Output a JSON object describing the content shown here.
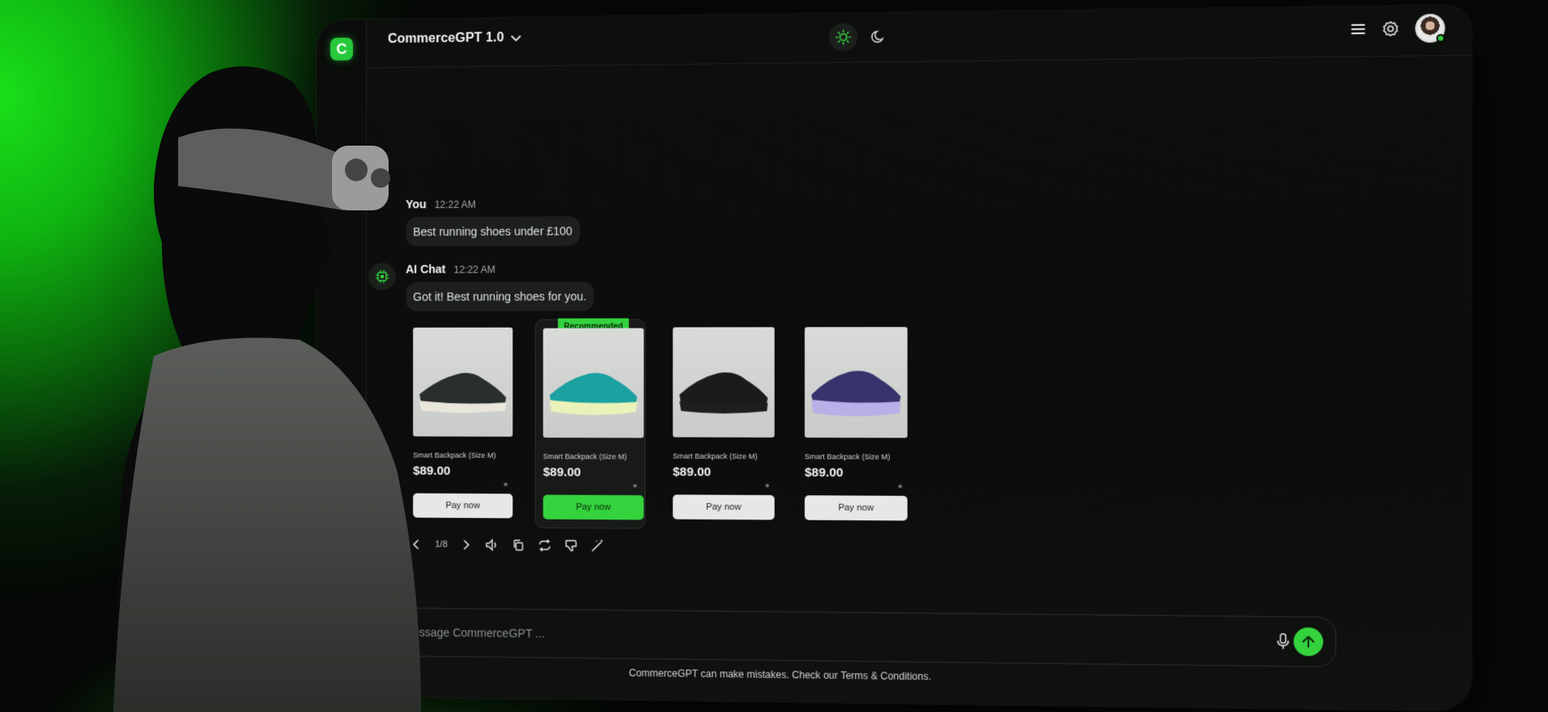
{
  "header": {
    "model_name": "CommerceGPT 1.0",
    "logo_letter": "C"
  },
  "chat": {
    "user": {
      "author": "You",
      "time": "12:22 AM",
      "text": "Best running shoes under £100"
    },
    "ai": {
      "author": "AI Chat",
      "time": "12:22 AM",
      "text": "Got it! Best running shoes for you."
    }
  },
  "products": [
    {
      "name": "Smart Backpack (Size M)",
      "price": "$89.00",
      "button": "Pay now",
      "recommended": false,
      "shoe_color": "#2a2e2c",
      "sole_color": "#e9e6dc"
    },
    {
      "name": "Smart Backpack (Size M)",
      "price": "$89.00",
      "button": "Pay now",
      "recommended": true,
      "badge": "Recommended",
      "shoe_color": "#1aa1a0",
      "sole_color": "#eaf1b9"
    },
    {
      "name": "Smart Backpack (Size M)",
      "price": "$89.00",
      "button": "Pay now",
      "recommended": false,
      "shoe_color": "#1a1b1c",
      "sole_color": "#1d1e20"
    },
    {
      "name": "Smart Backpack (Size M)",
      "price": "$89.00",
      "button": "Pay now",
      "recommended": false,
      "shoe_color": "#37336c",
      "sole_color": "#b8b0e6"
    }
  ],
  "pager": {
    "count": "1/8"
  },
  "composer": {
    "placeholder": "Message CommerceGPT ..."
  },
  "footer": {
    "disclaimer": "CommerceGPT can make mistakes. Check our Terms & Conditions."
  },
  "colors": {
    "accent": "#34d33e",
    "background": "#0b0c0b"
  },
  "icons": [
    "menu-icon",
    "gear-icon",
    "sun-icon",
    "moon-icon",
    "chevron-down-icon",
    "chevron-left-icon",
    "chevron-right-icon",
    "speaker-icon",
    "copy-icon",
    "refresh-icon",
    "thumbs-down-icon",
    "magic-wand-icon",
    "paperclip-icon",
    "microphone-icon",
    "arrow-up-icon",
    "chip-icon"
  ]
}
